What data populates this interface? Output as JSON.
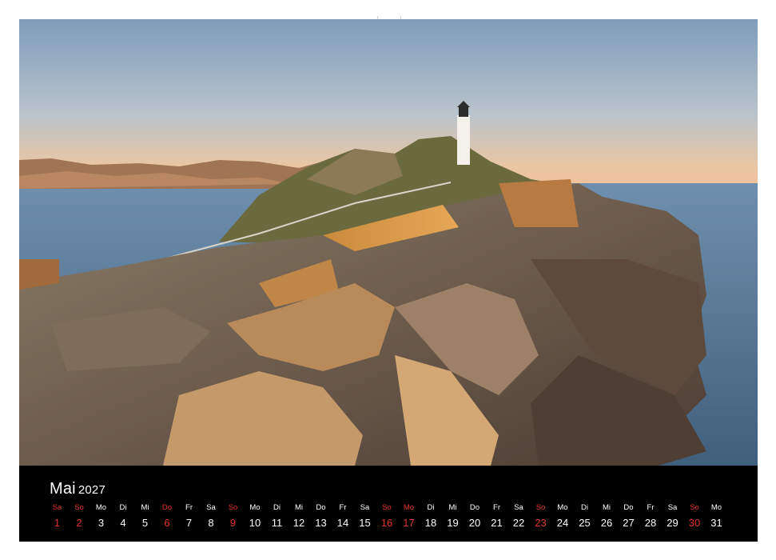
{
  "calendar": {
    "month": "Mai",
    "year": "2027",
    "days": [
      {
        "wd": "Sa",
        "num": "1",
        "holiday": true
      },
      {
        "wd": "So",
        "num": "2",
        "holiday": true
      },
      {
        "wd": "Mo",
        "num": "3",
        "holiday": false
      },
      {
        "wd": "Di",
        "num": "4",
        "holiday": false
      },
      {
        "wd": "Mi",
        "num": "5",
        "holiday": false
      },
      {
        "wd": "Do",
        "num": "6",
        "holiday": true
      },
      {
        "wd": "Fr",
        "num": "7",
        "holiday": false
      },
      {
        "wd": "Sa",
        "num": "8",
        "holiday": false
      },
      {
        "wd": "So",
        "num": "9",
        "holiday": true
      },
      {
        "wd": "Mo",
        "num": "10",
        "holiday": false
      },
      {
        "wd": "Di",
        "num": "11",
        "holiday": false
      },
      {
        "wd": "Mi",
        "num": "12",
        "holiday": false
      },
      {
        "wd": "Do",
        "num": "13",
        "holiday": false
      },
      {
        "wd": "Fr",
        "num": "14",
        "holiday": false
      },
      {
        "wd": "Sa",
        "num": "15",
        "holiday": false
      },
      {
        "wd": "So",
        "num": "16",
        "holiday": true
      },
      {
        "wd": "Mo",
        "num": "17",
        "holiday": true
      },
      {
        "wd": "Di",
        "num": "18",
        "holiday": false
      },
      {
        "wd": "Mi",
        "num": "19",
        "holiday": false
      },
      {
        "wd": "Do",
        "num": "20",
        "holiday": false
      },
      {
        "wd": "Fr",
        "num": "21",
        "holiday": false
      },
      {
        "wd": "Sa",
        "num": "22",
        "holiday": false
      },
      {
        "wd": "So",
        "num": "23",
        "holiday": true
      },
      {
        "wd": "Mo",
        "num": "24",
        "holiday": false
      },
      {
        "wd": "Di",
        "num": "25",
        "holiday": false
      },
      {
        "wd": "Mi",
        "num": "26",
        "holiday": false
      },
      {
        "wd": "Do",
        "num": "27",
        "holiday": false
      },
      {
        "wd": "Fr",
        "num": "28",
        "holiday": false
      },
      {
        "wd": "Sa",
        "num": "29",
        "holiday": false
      },
      {
        "wd": "So",
        "num": "30",
        "holiday": true
      },
      {
        "wd": "Mo",
        "num": "31",
        "holiday": false
      }
    ]
  },
  "colors": {
    "holiday": "#e2342b",
    "calendar_bg": "#000000",
    "text": "#ffffff"
  },
  "photo": {
    "subject": "lighthouse on coastal rocks at sunset"
  }
}
